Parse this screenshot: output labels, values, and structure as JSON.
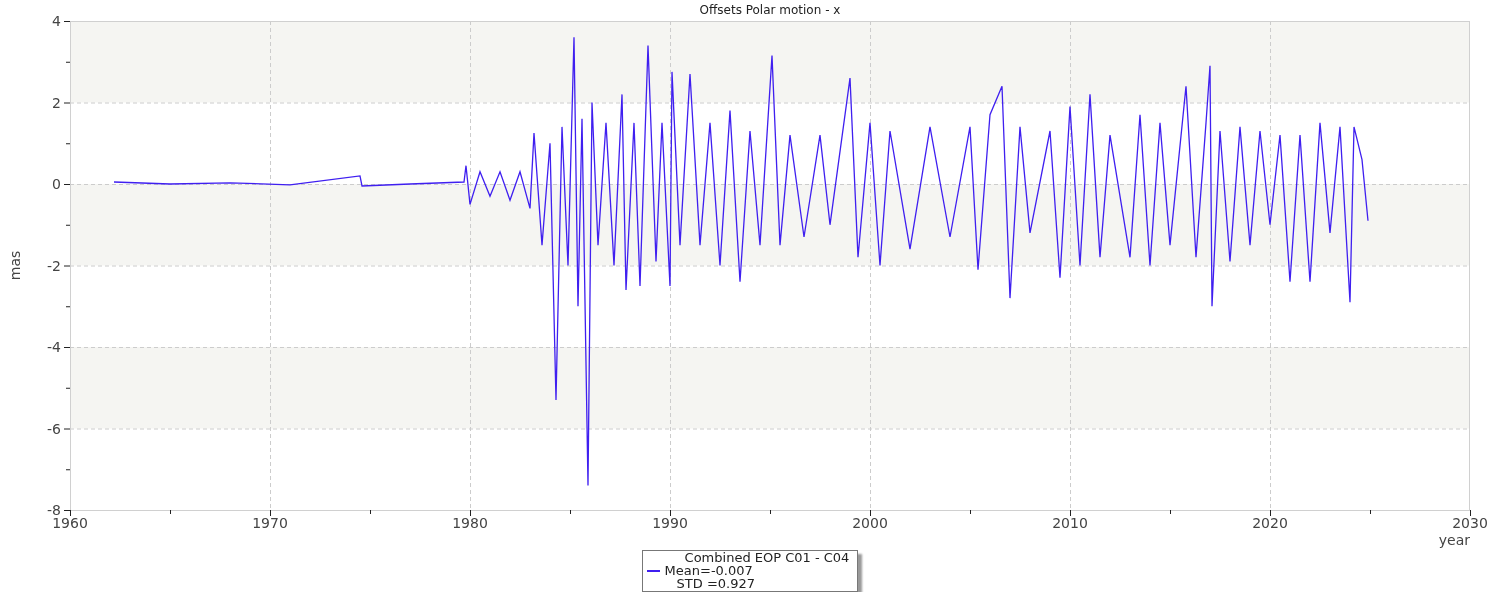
{
  "chart": {
    "chart_data": {
      "type": "line",
      "title": "Offsets Polar motion - x",
      "xlabel": "year",
      "ylabel": "mas",
      "xlim": [
        1960,
        2030
      ],
      "ylim": [
        -8,
        4
      ],
      "grid": true,
      "xticks": [
        1960,
        1970,
        1980,
        1990,
        2000,
        2010,
        2020,
        2030
      ],
      "yticks": [
        -8,
        -6,
        -4,
        -2,
        0,
        2,
        4
      ],
      "x": [
        1962.2,
        1965,
        1968,
        1971,
        1974.5,
        1974.6,
        1977,
        1979.7,
        1979.8,
        1980,
        1980.5,
        1981,
        1981.5,
        1982,
        1982.5,
        1983,
        1983.2,
        1983.6,
        1984,
        1984.3,
        1984.6,
        1984.9,
        1985.2,
        1985.4,
        1985.6,
        1985.9,
        1986.1,
        1986.4,
        1986.8,
        1987.2,
        1987.6,
        1987.8,
        1988.2,
        1988.5,
        1988.9,
        1989.3,
        1989.6,
        1990,
        1990.1,
        1990.5,
        1991,
        1991.5,
        1992,
        1992.5,
        1993,
        1993.5,
        1994,
        1994.5,
        1995.1,
        1995.5,
        1996,
        1996.7,
        1997.5,
        1998,
        1999,
        1999.4,
        2000,
        2000.5,
        2001,
        2002,
        2003,
        2004,
        2005,
        2005.4,
        2006,
        2006.6,
        2007,
        2007.5,
        2008,
        2009,
        2009.5,
        2010,
        2010.5,
        2011,
        2011.5,
        2012,
        2013,
        2013.5,
        2014,
        2014.5,
        2015,
        2015.8,
        2016.3,
        2016.8,
        2017,
        2017.1,
        2017.5,
        2018,
        2018.5,
        2019,
        2019.5,
        2020,
        2020.5,
        2021,
        2021.5,
        2022,
        2022.5,
        2023,
        2023.5,
        2024,
        2024.2,
        2024.6,
        2024.9
      ],
      "series": [
        {
          "name": "Combined EOP C01 - C04",
          "color": "#3f1ff0",
          "values": [
            0.05,
            0,
            0.03,
            -0.02,
            0.2,
            -0.05,
            0,
            0.05,
            0.45,
            -0.5,
            0.3,
            -0.3,
            0.3,
            -0.4,
            0.3,
            -0.6,
            1.25,
            -1.5,
            1.0,
            -5.3,
            1.4,
            -2.0,
            3.6,
            -3.0,
            1.6,
            -7.4,
            2.0,
            -1.5,
            1.5,
            -2.0,
            2.2,
            -2.6,
            1.5,
            -2.5,
            3.4,
            -1.9,
            1.5,
            -2.5,
            2.75,
            -1.5,
            2.7,
            -1.5,
            1.5,
            -2.0,
            1.8,
            -2.4,
            1.3,
            -1.5,
            3.15,
            -1.5,
            1.2,
            -1.3,
            1.2,
            -1.0,
            2.6,
            -1.8,
            1.5,
            -2.0,
            1.3,
            -1.6,
            1.4,
            -1.3,
            1.4,
            -2.1,
            1.7,
            2.4,
            -2.8,
            1.4,
            -1.2,
            1.3,
            -2.3,
            1.9,
            -2.0,
            2.2,
            -1.8,
            1.2,
            -1.8,
            1.7,
            -2.0,
            1.5,
            -1.5,
            2.4,
            -1.8,
            1.5,
            2.9,
            -3.0,
            1.3,
            -1.9,
            1.4,
            -1.5,
            1.3,
            -1.0,
            1.2,
            -2.4,
            1.2,
            -2.4,
            1.5,
            -1.2,
            1.4,
            -2.9,
            1.4,
            0.6,
            -0.9
          ]
        }
      ]
    },
    "legend": {
      "lines": [
        "Mean=-0.007",
        "STD =0.927"
      ]
    }
  }
}
